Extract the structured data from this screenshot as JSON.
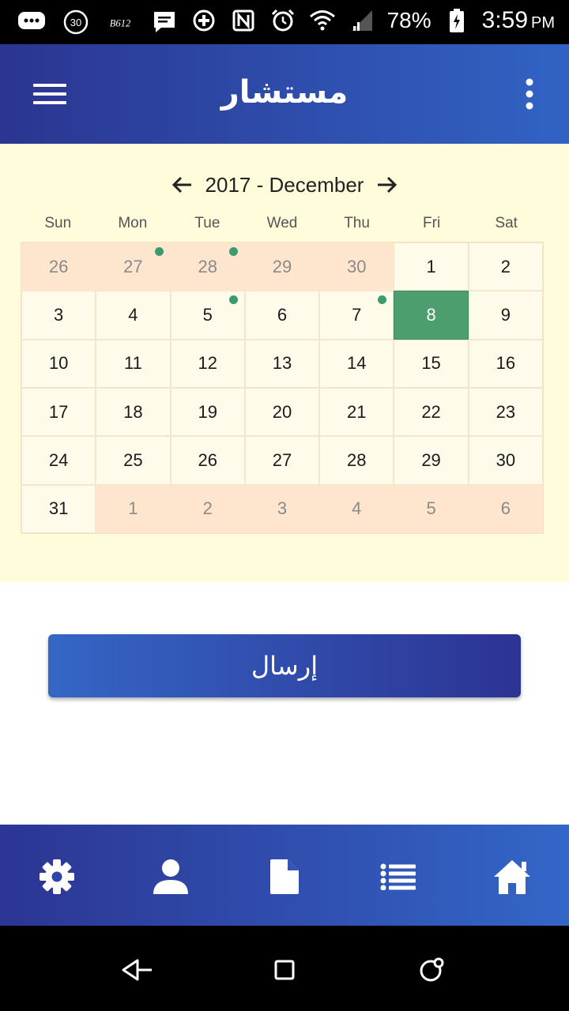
{
  "status_bar": {
    "battery": "78%",
    "time": "3:59",
    "ampm": "PM",
    "left_icons": [
      "chat-bubble-icon",
      "badge-30-icon",
      "b612-icon",
      "message-icon"
    ],
    "right_icons": [
      "data-saver-icon",
      "nfc-icon",
      "alarm-icon",
      "wifi-icon",
      "signal-icon",
      "battery-charging-icon"
    ],
    "badge_30": "30",
    "b612": "B612"
  },
  "app_bar": {
    "title": "مستشار",
    "menu_icon": "hamburger-menu-icon",
    "more_icon": "more-vert-icon"
  },
  "calendar": {
    "year": "2017",
    "month": "December",
    "separator": " - ",
    "weekdays": [
      "Sun",
      "Mon",
      "Tue",
      "Wed",
      "Thu",
      "Fri",
      "Sat"
    ],
    "weeks": [
      [
        {
          "d": "26",
          "other": true
        },
        {
          "d": "27",
          "other": true,
          "dot": true
        },
        {
          "d": "28",
          "other": true,
          "dot": true
        },
        {
          "d": "29",
          "other": true
        },
        {
          "d": "30",
          "other": true
        },
        {
          "d": "1"
        },
        {
          "d": "2"
        }
      ],
      [
        {
          "d": "3"
        },
        {
          "d": "4"
        },
        {
          "d": "5",
          "dot": true
        },
        {
          "d": "6"
        },
        {
          "d": "7",
          "dot": true
        },
        {
          "d": "8",
          "selected": true
        },
        {
          "d": "9"
        }
      ],
      [
        {
          "d": "10"
        },
        {
          "d": "11"
        },
        {
          "d": "12"
        },
        {
          "d": "13"
        },
        {
          "d": "14"
        },
        {
          "d": "15"
        },
        {
          "d": "16"
        }
      ],
      [
        {
          "d": "17"
        },
        {
          "d": "18"
        },
        {
          "d": "19"
        },
        {
          "d": "20"
        },
        {
          "d": "21"
        },
        {
          "d": "22"
        },
        {
          "d": "23"
        }
      ],
      [
        {
          "d": "24"
        },
        {
          "d": "25"
        },
        {
          "d": "26"
        },
        {
          "d": "27"
        },
        {
          "d": "28"
        },
        {
          "d": "29"
        },
        {
          "d": "30"
        }
      ],
      [
        {
          "d": "31"
        },
        {
          "d": "1",
          "other": true
        },
        {
          "d": "2",
          "other": true
        },
        {
          "d": "3",
          "other": true
        },
        {
          "d": "4",
          "other": true
        },
        {
          "d": "5",
          "other": true
        },
        {
          "d": "6",
          "other": true
        }
      ]
    ]
  },
  "send_button": {
    "label": "إرسال"
  },
  "bottom_nav": {
    "items": [
      {
        "icon": "settings-gear-icon"
      },
      {
        "icon": "person-icon"
      },
      {
        "icon": "document-icon"
      },
      {
        "icon": "list-icon"
      },
      {
        "icon": "home-icon"
      }
    ]
  },
  "system_nav": {
    "items": [
      {
        "icon": "back-triangle-icon"
      },
      {
        "icon": "recents-square-icon"
      },
      {
        "icon": "home-circle-icon"
      }
    ]
  },
  "colors": {
    "primary_dark": "#2b3591",
    "primary_light": "#3163c4",
    "calendar_bg": "#fefcdb",
    "other_month_bg": "#fde6cd",
    "selected_day": "#4d9e6e",
    "event_dot": "#3a9b6c"
  }
}
